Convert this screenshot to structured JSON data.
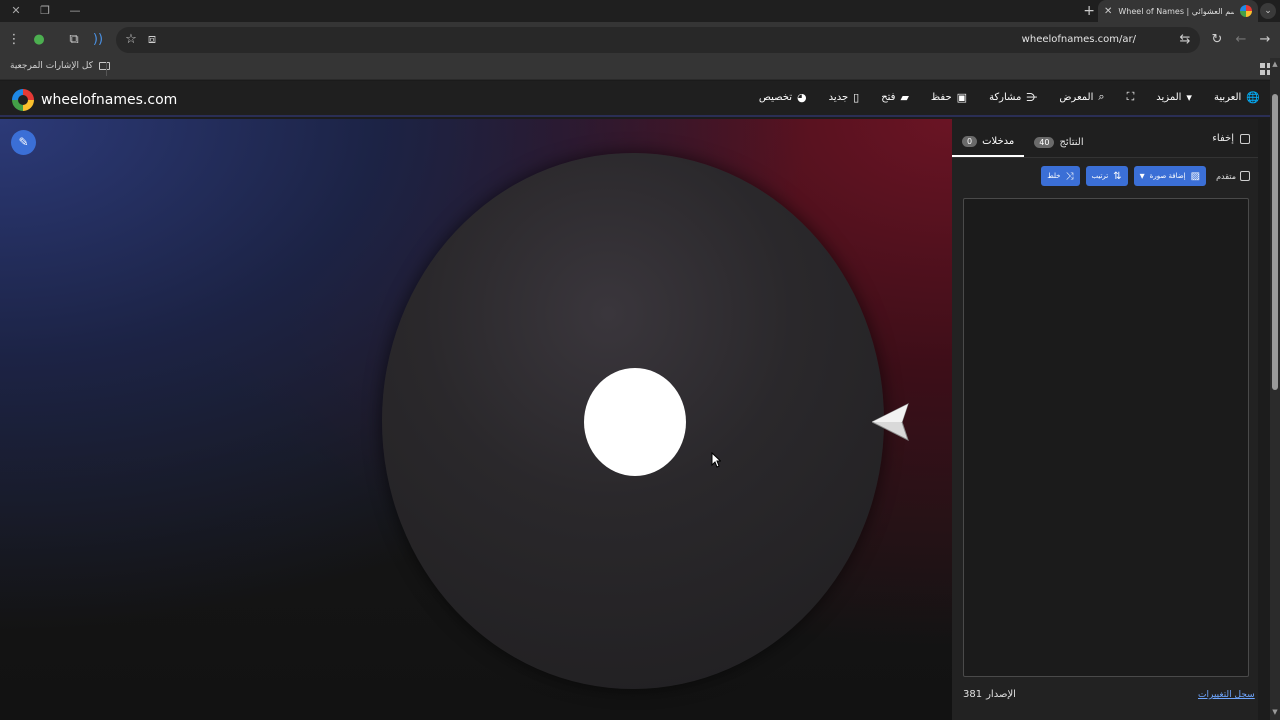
{
  "browser": {
    "tab_title": "Wheel of Names | عجلة الاسم العشوائي",
    "new_tab": "+",
    "url": "wheelofnames.com/ar/",
    "bookmarks_all_label": "كل الإشارات المرجعية"
  },
  "header": {
    "brand": "wheelofnames.com",
    "menu": {
      "language": "العربية",
      "more": "المزيد",
      "gallery": "المعرض",
      "share": "مشاركة",
      "save": "حفظ",
      "open": "فتح",
      "new": "جديد",
      "customize": "تخصيص"
    }
  },
  "panel": {
    "hide_label": "إخفاء",
    "tabs": {
      "entries_label": "مدخلات",
      "entries_count": "0",
      "results_label": "النتائج",
      "results_count": "40"
    },
    "advanced_label": "متقدم",
    "add_image_label": "إضافة صورة",
    "sort_label": "ترتيب",
    "shuffle_label": "خلط",
    "changelog_label": "سجل التغييرات",
    "version_label": "الإصدار",
    "version_number": "381"
  }
}
